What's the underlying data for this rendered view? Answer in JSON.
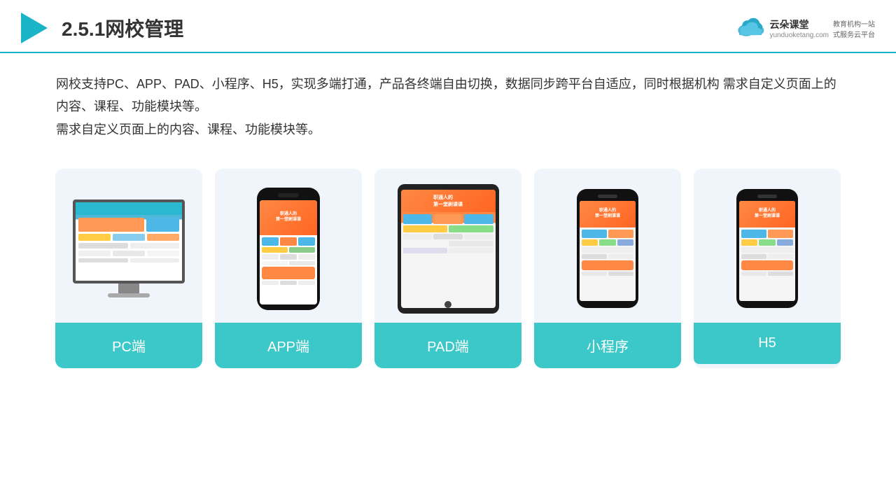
{
  "header": {
    "title": "2.5.1网校管理",
    "brand": {
      "name": "云朵课堂",
      "url": "yunduoketang.com",
      "slogan": "教育机构一站\n式服务云平台"
    }
  },
  "description": "网校支持PC、APP、PAD、小程序、H5，实现多端打通，产品各终端自由切换，数据同步跨平台自适应，同时根据机构\n需求自定义页面上的内容、课程、功能模块等。",
  "cards": [
    {
      "id": "pc",
      "label": "PC端"
    },
    {
      "id": "app",
      "label": "APP端"
    },
    {
      "id": "pad",
      "label": "PAD端"
    },
    {
      "id": "miniprogram",
      "label": "小程序"
    },
    {
      "id": "h5",
      "label": "H5"
    }
  ],
  "colors": {
    "accent": "#3cc8c8",
    "header_border": "#1ab3c8",
    "background": "#f0f4fb"
  }
}
